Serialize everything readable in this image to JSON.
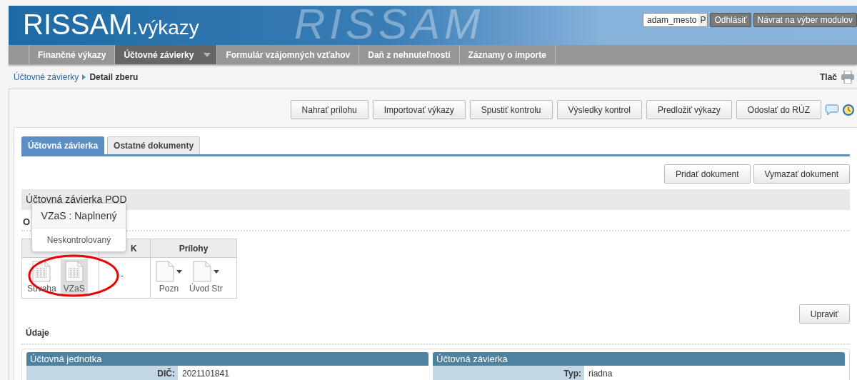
{
  "header": {
    "logo_main": "RISSAM",
    "logo_sub": ".výkazy",
    "watermark": "RISSAM",
    "user": "adam_mesto",
    "user_suffix": "P",
    "buttons": [
      "Odhlásiť",
      "Návrat na výber modulov"
    ]
  },
  "nav": [
    {
      "label": "Finančné výkazy",
      "selected": false,
      "dropdown": false
    },
    {
      "label": "Účtovné závierky",
      "selected": true,
      "dropdown": true
    },
    {
      "label": "Formulár vzájomných vzťahov",
      "selected": false,
      "dropdown": false
    },
    {
      "label": "Daň z nehnuteľností",
      "selected": false,
      "dropdown": false
    },
    {
      "label": "Záznamy o importe",
      "selected": false,
      "dropdown": false
    }
  ],
  "breadcrumb": {
    "link": "Účtovné závierky",
    "current": "Detail zberu"
  },
  "print_label": "Tlač",
  "toolbar": [
    "Nahrať prílohu",
    "Importovať výkazy",
    "Spustiť kontrolu",
    "Výsledky kontrol",
    "Predložiť výkazy",
    "Odoslať do RÚZ"
  ],
  "tabs": [
    {
      "label": "Účtovná závierka",
      "selected": true
    },
    {
      "label": "Ostatné dokumenty",
      "selected": false
    }
  ],
  "doc_buttons": [
    "Pridať dokument",
    "Vymazať dokument"
  ],
  "section_title": "Účtovná závierka POD",
  "subsection_title": "O",
  "reports": {
    "columns": [
      "",
      "K",
      "Prílohy"
    ],
    "groups": [
      {
        "items": [
          {
            "label": "Súvaha",
            "selected": false,
            "dropdown": false
          },
          {
            "label": "VZaS",
            "selected": true,
            "dropdown": false
          }
        ]
      },
      {
        "text": "-"
      },
      {
        "items": [
          {
            "label": "Pozn",
            "selected": false,
            "dropdown": true
          },
          {
            "label": "Úvod Str",
            "selected": false,
            "dropdown": true
          }
        ]
      }
    ]
  },
  "tooltip": {
    "title": "VZaS : Naplnený",
    "body": "Neskontrolovaný"
  },
  "edit_button": "Upraviť",
  "data_title": "Údaje",
  "panels": [
    {
      "title": "Účtovná jednotka",
      "rows": [
        {
          "label": "DIČ:",
          "value": "2021101841"
        }
      ]
    },
    {
      "title": "Účtovná závierka",
      "rows": [
        {
          "label": "Typ:",
          "value": "riadna"
        }
      ]
    }
  ]
}
